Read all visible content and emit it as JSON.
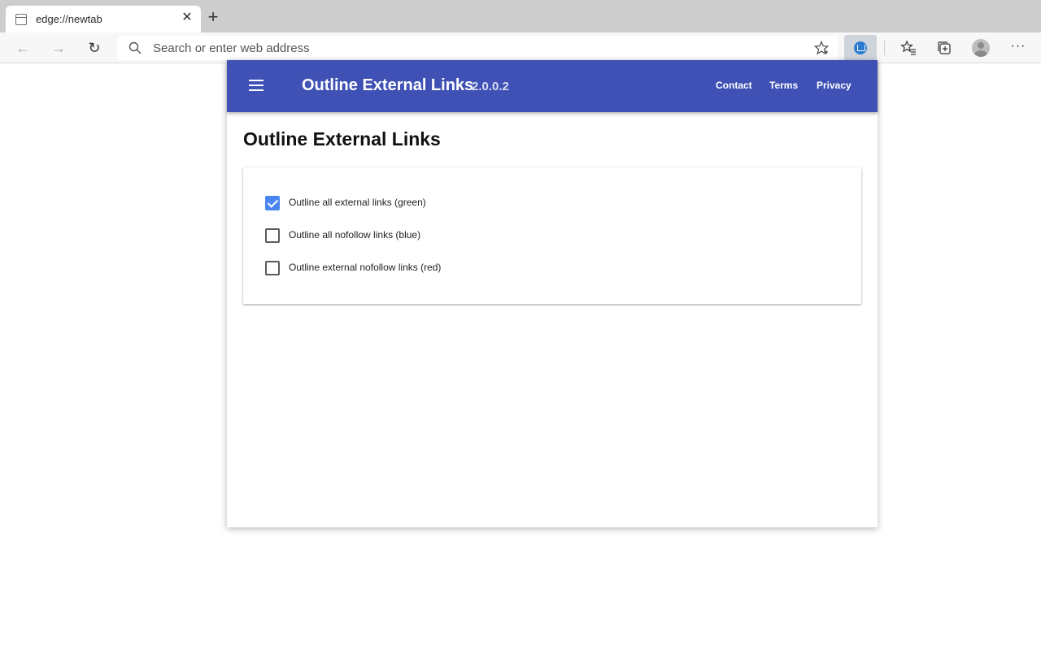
{
  "browser": {
    "tab": {
      "title": "edge://newtab"
    },
    "address_bar": {
      "placeholder": "Search or enter web address",
      "value": ""
    }
  },
  "extension": {
    "title": "Outline External Links",
    "version": "2.0.0.2",
    "nav": {
      "contact": "Contact",
      "terms": "Terms",
      "privacy": "Privacy"
    },
    "heading": "Outline External Links",
    "options": [
      {
        "label": "Outline all external links (green)",
        "checked": true
      },
      {
        "label": "Outline all nofollow links (blue)",
        "checked": false
      },
      {
        "label": "Outline external nofollow links (red)",
        "checked": false
      }
    ]
  },
  "colors": {
    "appbar": "#3f51b5",
    "checkbox_checked": "#4a86f0"
  }
}
